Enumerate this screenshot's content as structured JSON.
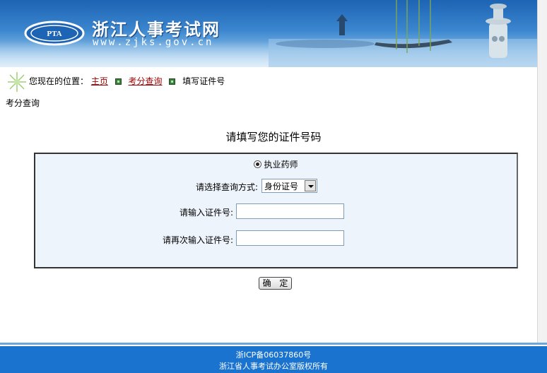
{
  "header": {
    "site_name": "浙江人事考试网",
    "site_url": "www.zjks.gov.cn",
    "logo_text": "PTA"
  },
  "breadcrumb": {
    "prefix": "您现在的位置：",
    "items": [
      {
        "label": "主页"
      },
      {
        "label": "考分查询"
      },
      {
        "label": "填写证件号"
      }
    ]
  },
  "section_label": "考分查询",
  "form": {
    "title": "请填写您的证件号码",
    "exam_option": "执业药师",
    "method_label": "请选择查询方式:",
    "method_selected": "身份证号",
    "id_label": "请输入证件号:",
    "id_value": "",
    "id_confirm_label": "请再次输入证件号:",
    "id_confirm_value": "",
    "submit_label": "确 定"
  },
  "footer": {
    "icp": "浙ICP备06037860号",
    "copyright": "浙江省人事考试办公室版权所有"
  },
  "colors": {
    "banner_blue": "#1d64b4",
    "footer_blue": "#1a73cf",
    "link_red": "#990000",
    "form_background": "#eef4fb"
  }
}
